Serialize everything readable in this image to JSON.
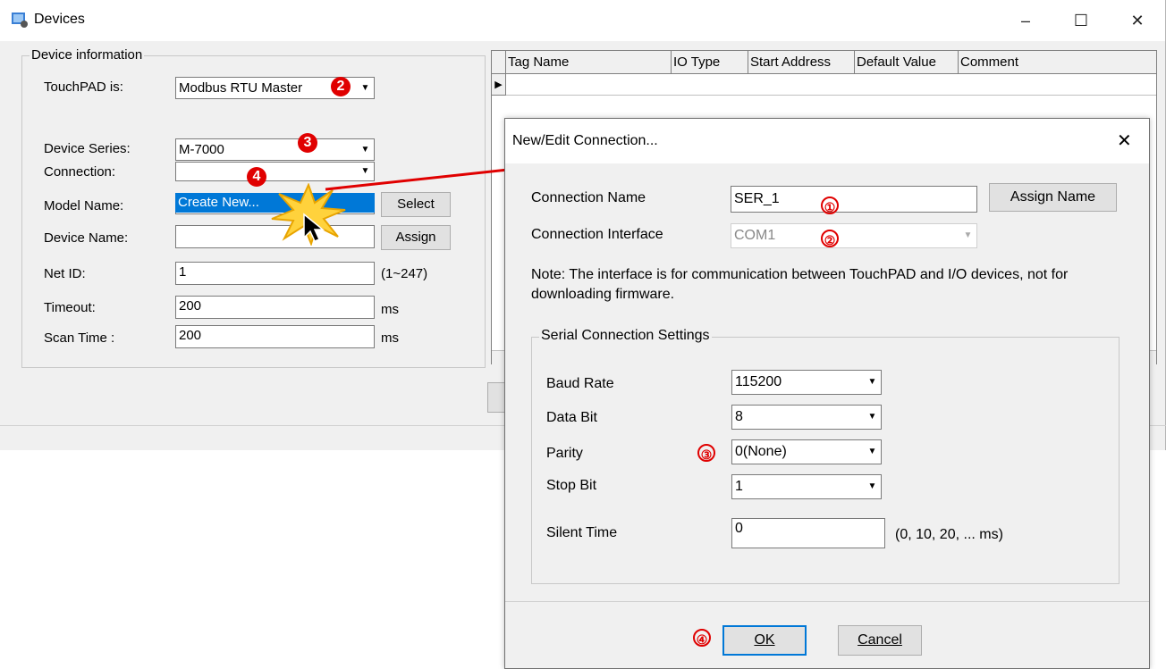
{
  "devices_window": {
    "title": "Devices",
    "controls": {
      "minimize": "–",
      "maximize": "☐",
      "close": "✕"
    },
    "device_info": {
      "legend": "Device information",
      "touchpad_label": "TouchPAD is:",
      "touchpad_value": "Modbus RTU Master",
      "series_label": "Device Series:",
      "series_value": "M-7000",
      "connection_label": "Connection:",
      "connection_value": "",
      "model_label": "Model Name:",
      "dropdown_option": "Create New...",
      "select_button": "Select",
      "device_name_label": "Device Name:",
      "device_name_value": "",
      "assign_button": "Assign",
      "netid_label": "Net ID:",
      "netid_value": "1",
      "netid_range": "(1~247)",
      "timeout_label": "Timeout:",
      "timeout_value": "200",
      "timeout_unit": "ms",
      "scan_label": "Scan Time :",
      "scan_value": "200",
      "scan_unit": "ms"
    },
    "grid": {
      "columns": [
        "Tag Name",
        "IO Type",
        "Start Address",
        "Default Value",
        "Comment"
      ],
      "row_marker": "▶"
    }
  },
  "dialog": {
    "title": "New/Edit Connection...",
    "close": "✕",
    "conn_name_label": "Connection Name",
    "conn_name_value": "SER_1",
    "assign_name_button": "Assign Name",
    "conn_iface_label": "Connection Interface",
    "conn_iface_value": "COM1",
    "note": "Note: The interface is for communication between TouchPAD and I/O devices, not for downloading firmware.",
    "serial": {
      "legend": "Serial Connection Settings",
      "baud_label": "Baud Rate",
      "baud_value": "115200",
      "databit_label": "Data Bit",
      "databit_value": "8",
      "parity_label": "Parity",
      "parity_value": "0(None)",
      "stopbit_label": "Stop Bit",
      "stopbit_value": "1",
      "silent_label": "Silent Time",
      "silent_value": "0",
      "silent_hint": "(0, 10, 20, ... ms)"
    },
    "ok_button": "OK",
    "cancel_button": "Cancel"
  },
  "annotations": {
    "step2": "2",
    "step3": "3",
    "step4": "4",
    "d1": "①",
    "d2": "②",
    "d3": "③",
    "d4": "④"
  },
  "colors": {
    "annotation_red": "#e00000",
    "selection_blue": "#0078d7"
  }
}
